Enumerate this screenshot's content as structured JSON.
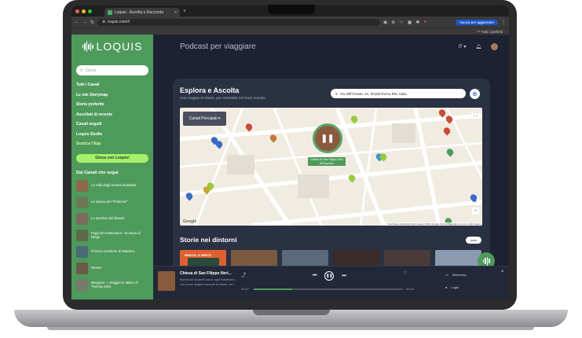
{
  "browser": {
    "tab_title": "Loquis - Ascolta e Racconta",
    "url": "loquis.com/#",
    "update_button": "Nuova per aggiornare",
    "bookmarks_label": "Tutti i preferiti"
  },
  "sidebar": {
    "brand": "LOQUIS",
    "search_placeholder": "Cerca",
    "nav": [
      {
        "label": "Tutti i Canali"
      },
      {
        "label": "Le mie Storymap"
      },
      {
        "label": "Storie preferite"
      },
      {
        "label": "Ascoltati di recente"
      },
      {
        "label": "Canali seguiti"
      },
      {
        "label": "Loquis Studio"
      },
      {
        "label": "Scarica l'App"
      }
    ],
    "play_button": "Gioca con Loquis!",
    "channels_title": "Dai Canali che segui",
    "channels": [
      {
        "label": "La Villa degli Amanti maledetti",
        "color": "#8a6a4a"
      },
      {
        "label": "La stanza del \"Rebecke\"",
        "color": "#6b7a55"
      },
      {
        "label": "Lo sportivo del diavolo",
        "color": "#7b6b5a"
      },
      {
        "label": "Fuga del mantovano - la storia di Ringo",
        "color": "#5f6a4a"
      },
      {
        "label": "Il lascio sciveltore di Malasco",
        "color": "#4a6a78"
      },
      {
        "label": "Nesem",
        "color": "#6a5a4a"
      },
      {
        "label": "Bergamo - «Viaggio in Italia» di Thomas Eliot",
        "color": "#7a7a6a"
      }
    ]
  },
  "header": {
    "title": "Podcast per viaggiare",
    "language": "IT"
  },
  "explore": {
    "title": "Esplora e Ascolta",
    "subtitle": "Una mappa di Storie, per orientarti nel (tuo) mondo.",
    "location_value": "Via dell'Orsata, 22, 00186 Roma RM, Italia",
    "channels_dropdown": "Canali Principali",
    "map_logo": "Google",
    "map_attribution": "Scorciatoie da tastiera  Dati mappa ©2024 Google  Termini  Segnala un errore nella mappa",
    "selected_story_label": "Chiesa di San Filippo Neri all'Esquilino"
  },
  "stories": {
    "title": "Storie nei dintorni",
    "all_button": "tutte",
    "thumbs": [
      {
        "label": "MINCOL & MIRCO",
        "color": "#e06030"
      },
      {
        "label": "",
        "color": "#7a5a40"
      },
      {
        "label": "",
        "color": "#5a6a7a"
      },
      {
        "label": "",
        "color": "#3a2a2a"
      },
      {
        "label": "",
        "color": "#4a3a3a"
      },
      {
        "label": "",
        "color": "#8a9ab0"
      }
    ]
  },
  "player": {
    "title": "Chiesa di San Filippo Neri...",
    "description": "Roma nei vicoletti sta in ogni trastevere, con cover angoli nascosti di storie, nei...",
    "time_elapsed": "00:27",
    "time_total": "00:35",
    "progress_fraction": 0.26,
    "discovery_label": "Discovery",
    "login_label": "Login"
  }
}
